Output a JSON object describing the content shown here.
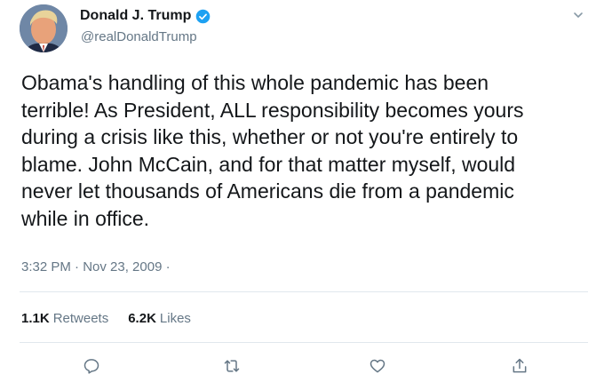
{
  "tweet": {
    "author": {
      "display_name": "Donald J. Trump",
      "handle": "@realDonaldTrump",
      "verified_icon": "verified-badge-icon",
      "avatar": "avatar-photo"
    },
    "text": "Obama's handling of this whole pandemic has been\nterrible! As President, ALL responsibility becomes yours\nduring a crisis like this, whether or not you're entirely to\nblame. John McCain, and for that matter myself, would\nnever let thousands of Americans die from a pandemic\nwhile in office.",
    "timestamp": "3:32 PM · Nov 23, 2009 ·",
    "stats": {
      "retweets_count": "1.1K",
      "retweets_label": "Retweets",
      "likes_count": "6.2K",
      "likes_label": "Likes"
    },
    "actions": [
      "reply-icon",
      "retweet-icon",
      "like-icon",
      "share-icon"
    ]
  },
  "colors": {
    "accent": "#1da1f2",
    "text": "#14171a",
    "secondary_text": "#657786",
    "divider": "#e1e8ed"
  }
}
